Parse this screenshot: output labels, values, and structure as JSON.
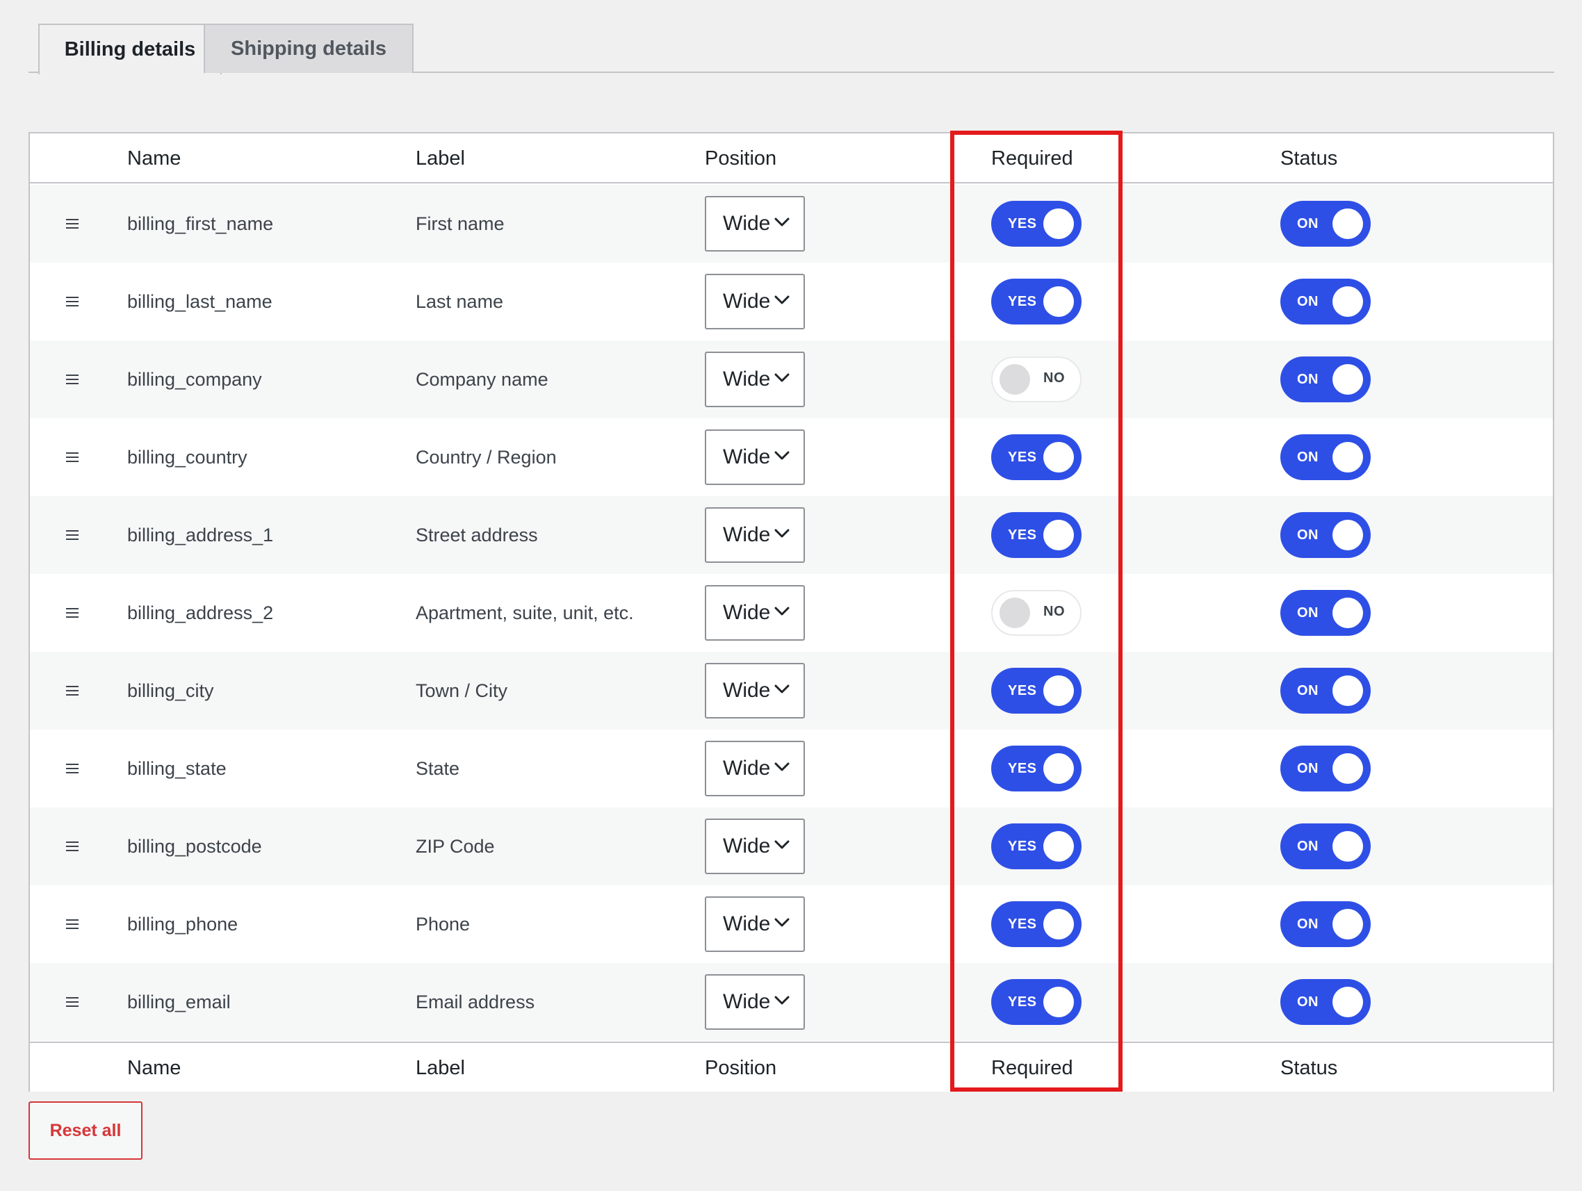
{
  "tabs": [
    {
      "label": "Billing details",
      "active": true
    },
    {
      "label": "Shipping details",
      "active": false
    }
  ],
  "columns": {
    "name": "Name",
    "label": "Label",
    "position": "Position",
    "required": "Required",
    "status": "Status"
  },
  "rows": [
    {
      "name": "billing_first_name",
      "label": "First name",
      "position": "Wide",
      "required": "YES",
      "status": "ON"
    },
    {
      "name": "billing_last_name",
      "label": "Last name",
      "position": "Wide",
      "required": "YES",
      "status": "ON"
    },
    {
      "name": "billing_company",
      "label": "Company name",
      "position": "Wide",
      "required": "NO",
      "status": "ON"
    },
    {
      "name": "billing_country",
      "label": "Country / Region",
      "position": "Wide",
      "required": "YES",
      "status": "ON"
    },
    {
      "name": "billing_address_1",
      "label": "Street address",
      "position": "Wide",
      "required": "YES",
      "status": "ON"
    },
    {
      "name": "billing_address_2",
      "label": "Apartment, suite, unit, etc.",
      "position": "Wide",
      "required": "NO",
      "status": "ON"
    },
    {
      "name": "billing_city",
      "label": "Town / City",
      "position": "Wide",
      "required": "YES",
      "status": "ON"
    },
    {
      "name": "billing_state",
      "label": "State",
      "position": "Wide",
      "required": "YES",
      "status": "ON"
    },
    {
      "name": "billing_postcode",
      "label": "ZIP Code",
      "position": "Wide",
      "required": "YES",
      "status": "ON"
    },
    {
      "name": "billing_phone",
      "label": "Phone",
      "position": "Wide",
      "required": "YES",
      "status": "ON"
    },
    {
      "name": "billing_email",
      "label": "Email address",
      "position": "Wide",
      "required": "YES",
      "status": "ON"
    }
  ],
  "reset_label": "Reset all",
  "colors": {
    "toggle_on": "#2e4fe6",
    "toggle_off": "#ffffff",
    "highlight": "#e41a1c",
    "danger": "#d63638"
  }
}
